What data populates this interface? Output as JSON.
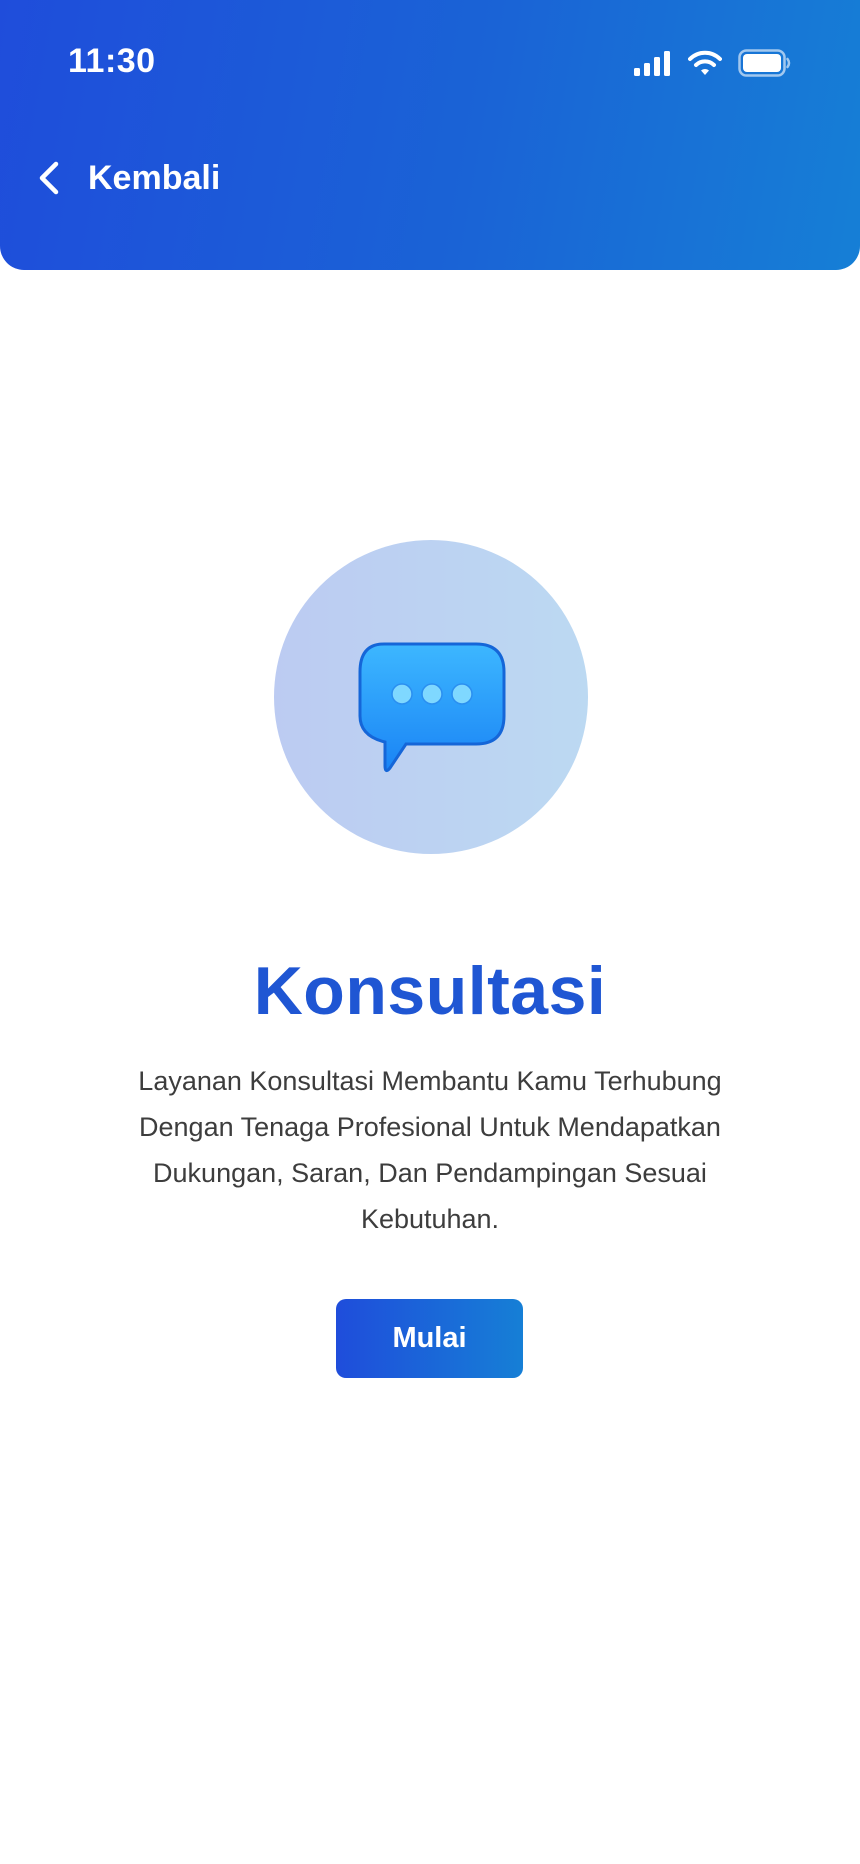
{
  "status_bar": {
    "time": "11:30",
    "icons": [
      "cellular-signal-icon",
      "wifi-icon",
      "battery-icon"
    ]
  },
  "header": {
    "back_icon": "chevron-left-icon",
    "back_label": "Kembali"
  },
  "hero": {
    "icon": "chat-bubble-icon"
  },
  "main": {
    "title": "Konsultasi",
    "description": "Layanan Konsultasi Membantu Kamu Terhubung Dengan Tenaga Profesional Untuk Mendapatkan Dukungan, Saran, Dan Pendampingan Sesuai Kebutuhan.",
    "start_button": "Mulai"
  },
  "colors": {
    "brand_blue": "#1f4ddb",
    "brand_light_blue": "#167fd6",
    "title_blue": "#1f56d3",
    "body_text": "#3d3d3d"
  }
}
